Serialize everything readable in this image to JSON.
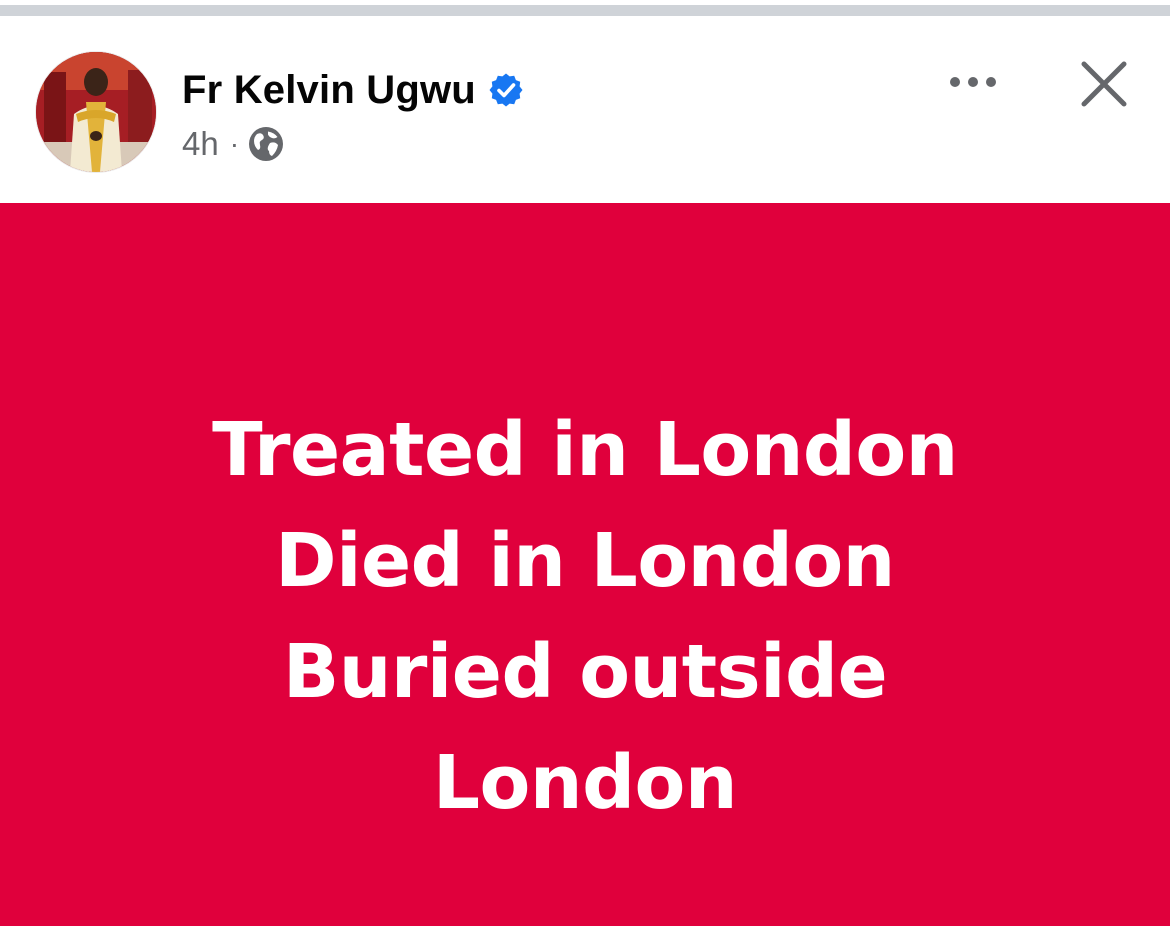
{
  "post": {
    "author": "Fr Kelvin Ugwu",
    "verified": true,
    "time": "4h",
    "separator": "·",
    "audience_icon": "globe-icon",
    "text_lines": [
      "Treated in London",
      "Died in London",
      "Buried outside",
      "London"
    ],
    "background_color": "#e0003c",
    "text_color": "#ffffff"
  },
  "actions": {
    "more_icon": "more-options-icon",
    "close_icon": "close-icon"
  },
  "colors": {
    "verified_badge": "#1877f2",
    "meta_text": "#65676b",
    "name_text": "#050505"
  }
}
